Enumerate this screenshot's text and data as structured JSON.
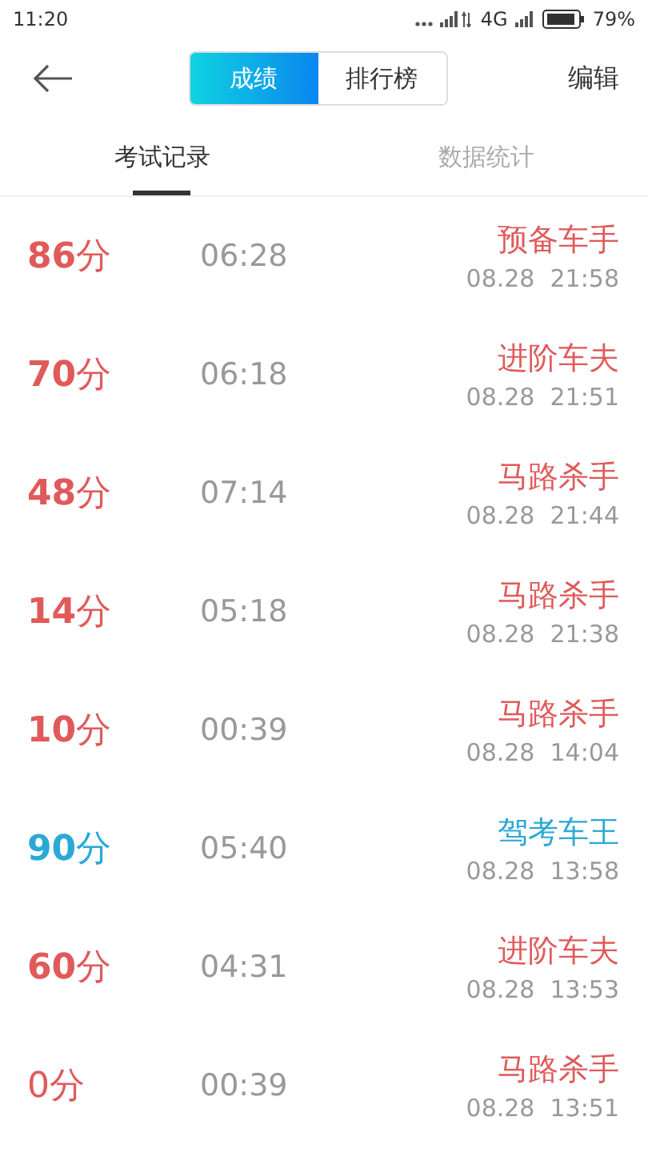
{
  "status_bar": {
    "time": "11:20",
    "network": "4G",
    "battery": "79%"
  },
  "header": {
    "segments": [
      {
        "label": "成绩",
        "selected": true
      },
      {
        "label": "排行榜",
        "selected": false
      }
    ],
    "action": "编辑"
  },
  "tabs": [
    {
      "label": "考试记录",
      "selected": true
    },
    {
      "label": "数据统计",
      "selected": false
    }
  ],
  "records": [
    {
      "score": "**86**分",
      "duration": "06:28",
      "rank": "预备车手",
      "date": "08.28  21:58",
      "color": "#e05a5a"
    },
    {
      "score": "**70**分",
      "duration": "06:18",
      "rank": "进阶车夫",
      "date": "08.28  21:51",
      "color": "#e05a5a"
    },
    {
      "score": "**48**分",
      "duration": "07:14",
      "rank": "马路杀手",
      "date": "08.28  21:44",
      "color": "#e05a5a"
    },
    {
      "score": "**14**分",
      "duration": "05:18",
      "rank": "马路杀手",
      "date": "08.28  21:38",
      "color": "#e05a5a"
    },
    {
      "score": "**10**分",
      "duration": "00:39",
      "rank": "马路杀手",
      "date": "08.28  14:04",
      "color": "#e05a5a"
    },
    {
      "score": "**90**分",
      "duration": "05:40",
      "rank": "驾考车王",
      "date": "08.28  13:58",
      "color": "#2aa9d6"
    },
    {
      "score": "**60**分",
      "duration": "04:31",
      "rank": "进阶车夫",
      "date": "08.28  13:53",
      "color": "#e05a5a"
    },
    {
      "score": "0分",
      "duration": "00:39",
      "rank": "马路杀手",
      "date": "08.28  13:51",
      "color": "#e05a5a"
    }
  ]
}
